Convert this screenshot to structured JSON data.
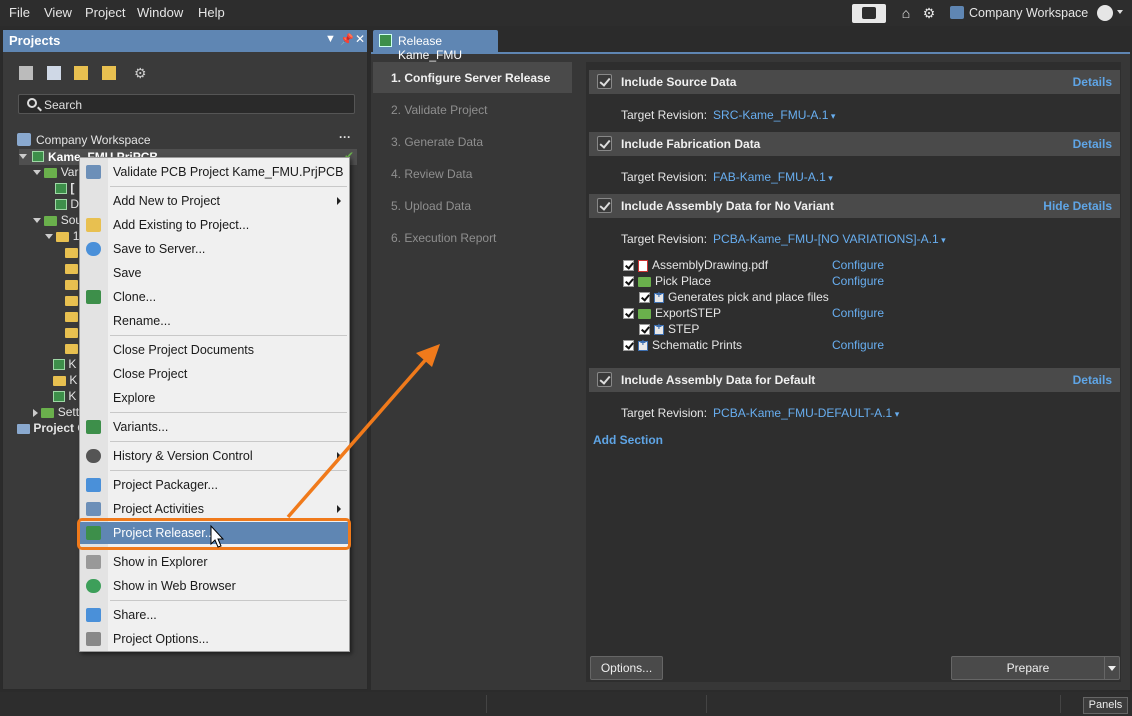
{
  "menubar": {
    "items": [
      "File",
      "View",
      "Project",
      "Window",
      "Help"
    ],
    "workspace_label": "Company Workspace"
  },
  "projects_panel": {
    "title": "Projects",
    "search_placeholder": "Search",
    "tree": {
      "workspace": "Company Workspace",
      "project": "Kame_FMU.PrjPCB",
      "rows": [
        "Vari",
        "[",
        "D",
        "Sou",
        "1.",
        "K",
        "K",
        "K",
        "Sett",
        "Project C"
      ]
    }
  },
  "context_menu": {
    "items": [
      {
        "label": "Validate PCB Project Kame_FMU.PrjPCB",
        "icon": "validate-icon"
      },
      {
        "label": "Add New to Project",
        "icon": "",
        "submenu": true
      },
      {
        "label": "Add Existing to Project...",
        "icon": "add-existing-icon"
      },
      {
        "label": "Save to Server...",
        "icon": "cloud-save-icon"
      },
      {
        "label": "Save",
        "icon": ""
      },
      {
        "label": "Clone...",
        "icon": "clone-icon"
      },
      {
        "label": "Rename...",
        "icon": ""
      },
      {
        "label": "Close Project Documents",
        "icon": ""
      },
      {
        "label": "Close Project",
        "icon": ""
      },
      {
        "label": "Explore",
        "icon": ""
      },
      {
        "label": "Variants...",
        "icon": "variants-icon"
      },
      {
        "label": "History & Version Control",
        "icon": "history-icon",
        "submenu": true
      },
      {
        "label": "Project Packager...",
        "icon": "packager-icon"
      },
      {
        "label": "Project Activities",
        "icon": "activities-icon",
        "submenu": true
      },
      {
        "label": "Project Releaser...",
        "icon": "releaser-icon"
      },
      {
        "label": "Show in Explorer",
        "icon": "explorer-icon"
      },
      {
        "label": "Show in Web Browser",
        "icon": "globe-icon"
      },
      {
        "label": "Share...",
        "icon": "share-icon"
      },
      {
        "label": "Project Options...",
        "icon": "options-icon"
      }
    ]
  },
  "document_tab": {
    "label": "Release Kame_FMU"
  },
  "steps": [
    "1. Configure Server Release",
    "2. Validate Project",
    "3. Generate Data",
    "4. Review Data",
    "5. Upload Data",
    "6. Execution Report"
  ],
  "sections": [
    {
      "title": "Include Source Data",
      "link": "Details",
      "revision_label": "Target Revision:",
      "revision": "SRC-Kame_FMU-A.1"
    },
    {
      "title": "Include Fabrication Data",
      "link": "Details",
      "revision_label": "Target Revision:",
      "revision": "FAB-Kame_FMU-A.1"
    },
    {
      "title": "Include Assembly Data for No Variant",
      "link": "Hide Details",
      "revision_label": "Target Revision:",
      "revision": "PCBA-Kame_FMU-[NO VARIATIONS]-A.1"
    },
    {
      "title": "Include Assembly Data for Default",
      "link": "Details",
      "revision_label": "Target Revision:",
      "revision": "PCBA-Kame_FMU-DEFAULT-A.1"
    }
  ],
  "assembly_items": [
    {
      "label": "AssemblyDrawing.pdf",
      "configure": "Configure"
    },
    {
      "label": "Pick Place",
      "configure": "Configure"
    },
    {
      "label": "Generates pick and place files",
      "configure": ""
    },
    {
      "label": "ExportSTEP",
      "configure": "Configure"
    },
    {
      "label": "STEP",
      "configure": ""
    },
    {
      "label": "Schematic Prints",
      "configure": "Configure"
    }
  ],
  "add_section": "Add Section",
  "buttons": {
    "options": "Options...",
    "prepare": "Prepare",
    "panels": "Panels"
  },
  "colors": {
    "accent": "#5f86b3",
    "highlight": "#f07a1b",
    "link": "#5fa5e6"
  }
}
